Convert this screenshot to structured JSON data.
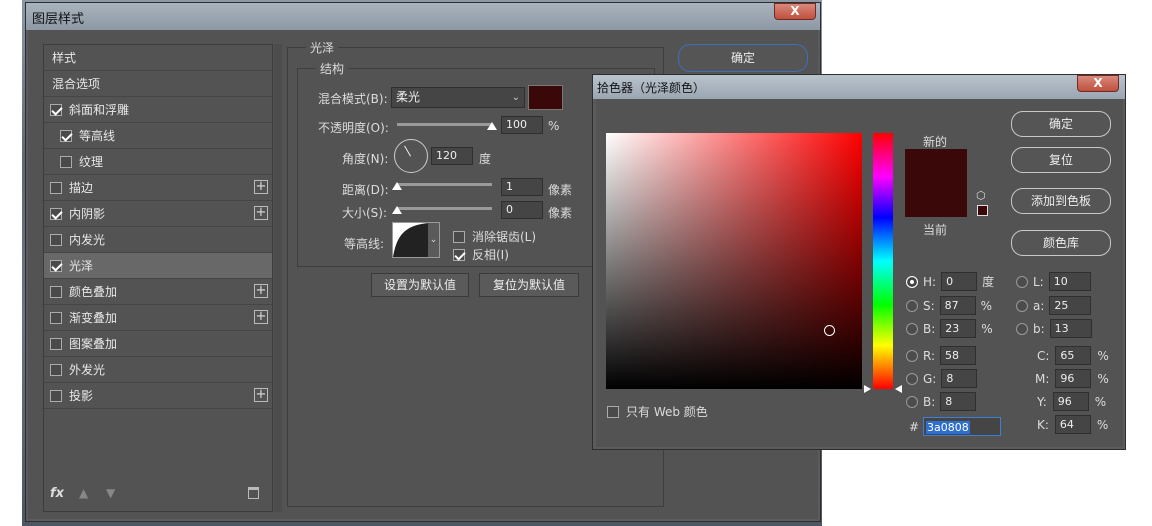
{
  "layer_style_dialog": {
    "title": "图层样式",
    "close_label": "X",
    "ok_label": "确定",
    "styles_list": [
      {
        "label": "样式",
        "checkbox": false,
        "checked": false,
        "plus": false,
        "indent": false
      },
      {
        "label": "混合选项",
        "checkbox": false,
        "checked": false,
        "plus": false,
        "indent": false
      },
      {
        "label": "斜面和浮雕",
        "checkbox": true,
        "checked": true,
        "plus": false,
        "indent": false
      },
      {
        "label": "等高线",
        "checkbox": true,
        "checked": true,
        "plus": false,
        "indent": true
      },
      {
        "label": "纹理",
        "checkbox": true,
        "checked": false,
        "plus": false,
        "indent": true
      },
      {
        "label": "描边",
        "checkbox": true,
        "checked": false,
        "plus": true,
        "indent": false
      },
      {
        "label": "内阴影",
        "checkbox": true,
        "checked": true,
        "plus": true,
        "indent": false
      },
      {
        "label": "内发光",
        "checkbox": true,
        "checked": false,
        "plus": false,
        "indent": false
      },
      {
        "label": "光泽",
        "checkbox": true,
        "checked": true,
        "plus": false,
        "indent": false,
        "selected": true
      },
      {
        "label": "颜色叠加",
        "checkbox": true,
        "checked": false,
        "plus": true,
        "indent": false
      },
      {
        "label": "渐变叠加",
        "checkbox": true,
        "checked": false,
        "plus": true,
        "indent": false
      },
      {
        "label": "图案叠加",
        "checkbox": true,
        "checked": false,
        "plus": false,
        "indent": false
      },
      {
        "label": "外发光",
        "checkbox": true,
        "checked": false,
        "plus": false,
        "indent": false
      },
      {
        "label": "投影",
        "checkbox": true,
        "checked": false,
        "plus": true,
        "indent": false
      }
    ],
    "footer": {
      "fx_label": "fx"
    },
    "satin": {
      "group_title": "光泽",
      "structure_title": "结构",
      "blend_mode_label": "混合模式(B):",
      "blend_mode_value": "柔光",
      "opacity_label": "不透明度(O):",
      "opacity_value": "100",
      "opacity_unit": "%",
      "angle_label": "角度(N):",
      "angle_value": "120",
      "angle_unit": "度",
      "distance_label": "距离(D):",
      "distance_value": "1",
      "distance_unit": "像素",
      "size_label": "大小(S):",
      "size_value": "0",
      "size_unit": "像素",
      "contour_label": "等高线:",
      "antialias_label": "消除锯齿(L)",
      "antialias_checked": false,
      "invert_label": "反相(I)",
      "invert_checked": true,
      "default_btn": "设置为默认值",
      "reset_btn": "复位为默认值",
      "color": "#3a0808",
      "opacity_level": 1.0,
      "distance_level": 0.0,
      "size_level": 0.0
    }
  },
  "color_picker": {
    "title": "拾色器（光泽颜色）",
    "close_label": "X",
    "ok_label": "确定",
    "reset_label": "复位",
    "add_swatch_label": "添加到色板",
    "libraries_label": "颜色库",
    "new_label": "新的",
    "current_label": "当前",
    "web_only_label": "只有 Web 颜色",
    "hsb": {
      "H": "0",
      "S": "87",
      "B": "23",
      "H_unit": "度",
      "S_unit": "%",
      "B_unit": "%"
    },
    "rgb": {
      "R": "58",
      "G": "8",
      "B": "8"
    },
    "lab": {
      "L": "10",
      "a": "25",
      "b": "13"
    },
    "cmyk": {
      "C": "65",
      "M": "96",
      "Y": "96",
      "K": "64",
      "unit": "%"
    },
    "hex_label": "#",
    "hex_value": "3a0808",
    "new_color": "#3a0808",
    "current_color": "#3a0808"
  }
}
